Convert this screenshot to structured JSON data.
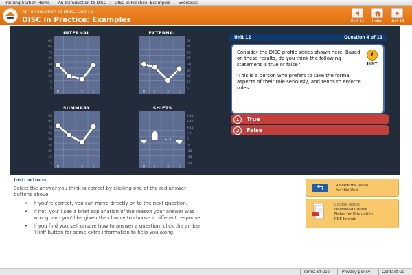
{
  "breadcrumb": [
    "Training Station Home",
    "An Introduction to DISC",
    "DISC in Practice: Examples",
    "Exercises"
  ],
  "header": {
    "subtitle": "An Introduction to DISC, Unit 12",
    "title": "DISC in Practice: Examples",
    "nav": {
      "prev_label": "Unit 11",
      "index_label": "Index",
      "next_label": "Unit 13"
    },
    "colors": {
      "bar": "#e8781b",
      "nav_icon": "#e2701a"
    }
  },
  "charts": {
    "internal": {
      "title": "INTERNAL",
      "values": {
        "D": 0,
        "I": -23,
        "S": -30,
        "C": 0
      }
    },
    "external": {
      "title": "EXTERNAL",
      "values": {
        "D": 2,
        "I": -5,
        "S": -32,
        "C": -8
      }
    },
    "summary": {
      "title": "SUMMARY",
      "values": {
        "D": 30,
        "I": 10,
        "S": -5,
        "C": 28
      }
    },
    "shifts": {
      "title": "SHIFTS",
      "values": {
        "D": -8,
        "I": 20,
        "S": -2,
        "C": -9
      }
    },
    "axis_letters": [
      "D",
      "I",
      "S",
      "C"
    ],
    "ticks_left": [
      "95",
      "85",
      "75",
      "65",
      "50",
      "35",
      "25",
      "15",
      "5"
    ],
    "ticks_right": [
      "+50",
      "+30",
      "+15",
      "+5",
      "0",
      "-5",
      "-15",
      "-30",
      "-50"
    ]
  },
  "question": {
    "unit_label": "Unit 12",
    "progress": "Question 4 of 11",
    "text": "Consider the DISC profile series shown here. Based on these results, do you think the following statement is true or false?",
    "statement": "'This is a person who prefers to take the formal aspects of their role seriously, and tends to enforce rules.'",
    "hint_label": "HINT",
    "hint_icon": "i"
  },
  "answers": [
    {
      "num": "1",
      "label": "True"
    },
    {
      "num": "2",
      "label": "False"
    }
  ],
  "instructions": {
    "heading": "Instructions",
    "text": "Select the answer you think is correct by clicking one of the red answer buttons above.",
    "bullets": [
      "If you're correct, you can move directly on to the next question.",
      "If not, you'll see a brief explanation of the reason your answer was wrong, and you'll be given the chance to choose a different response.",
      "If you find yourself unsure how to answer a question, click the amber 'Hint' button for some extra information to help you along."
    ],
    "bullet_glyph": "•"
  },
  "resources": {
    "video": {
      "line1": "Review the video",
      "line2": "for this Unit"
    },
    "notes": {
      "line1": "Course Notes",
      "line2": "Download Course",
      "line3": "Notes for this unit in",
      "line4": "PDF format"
    }
  },
  "footer": {
    "terms": "Terms of use",
    "privacy": "Privacy policy",
    "contact": "Contact us"
  }
}
